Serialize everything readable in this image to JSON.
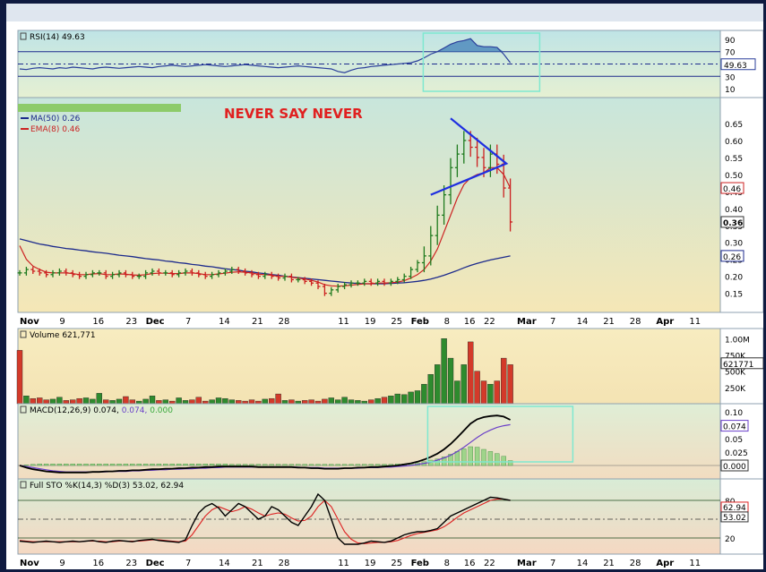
{
  "header": {
    "rsi_label": "RSI(14) 49.63",
    "ma_label": "MA(50) 0.26",
    "ema_label": "EMA(8) 0.46",
    "annotation": "NEVER SAY NEVER",
    "volume_label": "Volume 621,771",
    "macd_name": "MACD(12,26,9)",
    "macd_v1": "0.074,",
    "macd_v2": "0.074,",
    "macd_v3": "0.000",
    "sto_label": "Full STO %K(14,3) %D(3) 53.02, 62.94"
  },
  "colors": {
    "up": "#1e7a1e",
    "down": "#cc1f1f",
    "ma50": "#1c2a8c",
    "ema8": "#cc2222",
    "annotation": "#e02020",
    "triangle": "#1f2fe0",
    "highlight": "#7fe8d0"
  },
  "chart_data": [
    {
      "type": "line",
      "name": "rsi",
      "ylim": [
        0,
        100
      ],
      "yticks": [
        "90",
        "70",
        "50",
        "30",
        "10"
      ],
      "ytick_values": [
        90,
        70,
        50,
        30,
        10
      ],
      "reference_levels": [
        70,
        30
      ],
      "last_value": "49.63",
      "values": [
        42,
        41,
        43,
        44,
        43,
        42,
        44,
        43,
        45,
        44,
        43,
        42,
        44,
        45,
        44,
        43,
        44,
        45,
        46,
        45,
        44,
        46,
        47,
        48,
        47,
        46,
        47,
        48,
        49,
        48,
        47,
        46,
        47,
        48,
        49,
        48,
        47,
        46,
        45,
        44,
        45,
        46,
        47,
        46,
        45,
        44,
        43,
        42,
        38,
        36,
        40,
        43,
        44,
        46,
        47,
        48,
        49,
        50,
        51,
        52,
        55,
        60,
        66,
        70,
        76,
        82,
        86,
        88,
        91,
        80,
        78,
        78,
        77,
        66,
        52
      ]
    },
    {
      "type": "line",
      "name": "price",
      "x_labels": [
        "Nov",
        "9",
        "16",
        "23",
        "Dec",
        "7",
        "14",
        "21",
        "28",
        "11",
        "19",
        "25",
        "Feb",
        "8",
        "16",
        "22",
        "Mar",
        "7",
        "14",
        "21",
        "28",
        "Apr",
        "11"
      ],
      "ylim": [
        0.12,
        0.7
      ],
      "yticks": [
        "0.65",
        "0.60",
        "0.55",
        "0.50",
        "0.45",
        "0.40",
        "0.35",
        "0.30",
        "0.25",
        "0.20",
        "0.15"
      ],
      "ytick_values": [
        0.65,
        0.6,
        0.55,
        0.5,
        0.45,
        0.4,
        0.35,
        0.3,
        0.25,
        0.2,
        0.15
      ],
      "last_price": "0.36",
      "ema_last": "0.46",
      "ma_last": "0.26",
      "close": [
        0.21,
        0.22,
        0.215,
        0.21,
        0.205,
        0.21,
        0.215,
        0.21,
        0.205,
        0.2,
        0.205,
        0.21,
        0.21,
        0.2,
        0.205,
        0.21,
        0.205,
        0.2,
        0.2,
        0.21,
        0.215,
        0.21,
        0.21,
        0.205,
        0.21,
        0.215,
        0.21,
        0.205,
        0.2,
        0.205,
        0.21,
        0.215,
        0.22,
        0.215,
        0.21,
        0.205,
        0.2,
        0.205,
        0.2,
        0.195,
        0.2,
        0.19,
        0.19,
        0.185,
        0.18,
        0.17,
        0.15,
        0.16,
        0.17,
        0.175,
        0.18,
        0.18,
        0.185,
        0.18,
        0.185,
        0.18,
        0.185,
        0.19,
        0.2,
        0.22,
        0.24,
        0.26,
        0.32,
        0.38,
        0.44,
        0.52,
        0.56,
        0.6,
        0.58,
        0.55,
        0.52,
        0.56,
        0.53,
        0.46,
        0.36
      ],
      "ma50": [
        0.31,
        0.305,
        0.3,
        0.295,
        0.292,
        0.288,
        0.285,
        0.282,
        0.28,
        0.277,
        0.275,
        0.272,
        0.27,
        0.268,
        0.265,
        0.262,
        0.26,
        0.258,
        0.255,
        0.252,
        0.25,
        0.248,
        0.245,
        0.243,
        0.24,
        0.238,
        0.235,
        0.233,
        0.23,
        0.228,
        0.225,
        0.222,
        0.22,
        0.218,
        0.215,
        0.213,
        0.21,
        0.208,
        0.205,
        0.203,
        0.2,
        0.198,
        0.196,
        0.194,
        0.192,
        0.19,
        0.188,
        0.186,
        0.184,
        0.182,
        0.18,
        0.179,
        0.178,
        0.178,
        0.178,
        0.178,
        0.179,
        0.18,
        0.181,
        0.183,
        0.185,
        0.188,
        0.192,
        0.197,
        0.203,
        0.21,
        0.217,
        0.225,
        0.232,
        0.238,
        0.243,
        0.248,
        0.252,
        0.256,
        0.26
      ],
      "ema8": [
        0.29,
        0.25,
        0.23,
        0.22,
        0.212,
        0.21,
        0.21,
        0.21,
        0.208,
        0.205,
        0.205,
        0.207,
        0.208,
        0.205,
        0.205,
        0.207,
        0.206,
        0.204,
        0.203,
        0.205,
        0.208,
        0.209,
        0.209,
        0.208,
        0.208,
        0.21,
        0.21,
        0.208,
        0.205,
        0.205,
        0.207,
        0.209,
        0.212,
        0.213,
        0.212,
        0.21,
        0.206,
        0.205,
        0.203,
        0.2,
        0.2,
        0.197,
        0.195,
        0.192,
        0.188,
        0.183,
        0.175,
        0.172,
        0.171,
        0.172,
        0.174,
        0.176,
        0.178,
        0.178,
        0.18,
        0.18,
        0.181,
        0.183,
        0.187,
        0.195,
        0.205,
        0.22,
        0.245,
        0.28,
        0.33,
        0.38,
        0.43,
        0.47,
        0.49,
        0.5,
        0.505,
        0.52,
        0.52,
        0.5,
        0.46
      ]
    },
    {
      "type": "bar",
      "name": "volume",
      "ylim": [
        0,
        1100000
      ],
      "yticks": [
        "1.00M",
        "750K",
        "500K",
        "250K"
      ],
      "ytick_values": [
        1000000,
        750000,
        500000,
        250000
      ],
      "last_value": "621771",
      "values": [
        820000,
        120000,
        80000,
        90000,
        60000,
        70000,
        100000,
        50000,
        60000,
        80000,
        90000,
        70000,
        160000,
        60000,
        50000,
        70000,
        110000,
        60000,
        40000,
        70000,
        120000,
        50000,
        60000,
        40000,
        90000,
        50000,
        60000,
        100000,
        40000,
        60000,
        90000,
        80000,
        60000,
        50000,
        40000,
        60000,
        40000,
        70000,
        80000,
        150000,
        50000,
        60000,
        40000,
        50000,
        60000,
        40000,
        70000,
        90000,
        60000,
        100000,
        60000,
        50000,
        40000,
        60000,
        80000,
        100000,
        120000,
        150000,
        140000,
        180000,
        200000,
        300000,
        450000,
        600000,
        1000000,
        700000,
        350000,
        600000,
        950000,
        500000,
        350000,
        300000,
        350000,
        700000,
        600000
      ]
    },
    {
      "type": "line",
      "name": "macd",
      "ylim": [
        -0.02,
        0.11
      ],
      "yticks": [
        "0.10",
        "0.074",
        "0.05",
        "0.025",
        "0.000"
      ],
      "ytick_values": [
        0.1,
        0.074,
        0.05,
        0.025,
        0.0
      ],
      "macd": [
        0.0,
        -0.004,
        -0.007,
        -0.009,
        -0.011,
        -0.012,
        -0.013,
        -0.013,
        -0.013,
        -0.013,
        -0.013,
        -0.012,
        -0.012,
        -0.011,
        -0.011,
        -0.01,
        -0.01,
        -0.009,
        -0.009,
        -0.008,
        -0.007,
        -0.007,
        -0.006,
        -0.006,
        -0.005,
        -0.005,
        -0.004,
        -0.004,
        -0.003,
        -0.003,
        -0.002,
        -0.002,
        -0.002,
        -0.002,
        -0.002,
        -0.002,
        -0.003,
        -0.003,
        -0.003,
        -0.003,
        -0.003,
        -0.003,
        -0.004,
        -0.004,
        -0.005,
        -0.005,
        -0.006,
        -0.006,
        -0.006,
        -0.005,
        -0.005,
        -0.004,
        -0.004,
        -0.003,
        -0.003,
        -0.002,
        -0.001,
        0.0,
        0.002,
        0.004,
        0.007,
        0.011,
        0.016,
        0.022,
        0.03,
        0.04,
        0.052,
        0.065,
        0.078,
        0.086,
        0.09,
        0.092,
        0.093,
        0.091,
        0.085
      ],
      "signal": [
        0.0,
        -0.002,
        -0.004,
        -0.006,
        -0.008,
        -0.01,
        -0.011,
        -0.012,
        -0.012,
        -0.012,
        -0.012,
        -0.012,
        -0.012,
        -0.012,
        -0.011,
        -0.011,
        -0.011,
        -0.01,
        -0.01,
        -0.009,
        -0.009,
        -0.008,
        -0.008,
        -0.007,
        -0.007,
        -0.006,
        -0.006,
        -0.005,
        -0.005,
        -0.004,
        -0.004,
        -0.003,
        -0.003,
        -0.003,
        -0.003,
        -0.003,
        -0.003,
        -0.003,
        -0.003,
        -0.003,
        -0.003,
        -0.003,
        -0.003,
        -0.004,
        -0.004,
        -0.004,
        -0.005,
        -0.005,
        -0.005,
        -0.005,
        -0.005,
        -0.005,
        -0.004,
        -0.004,
        -0.004,
        -0.003,
        -0.003,
        -0.002,
        -0.001,
        0.0,
        0.002,
        0.004,
        0.006,
        0.01,
        0.014,
        0.019,
        0.026,
        0.034,
        0.043,
        0.052,
        0.06,
        0.066,
        0.071,
        0.074,
        0.076
      ],
      "hist": [
        0.0,
        0.001,
        0.002,
        0.003,
        0.003,
        0.003,
        0.003,
        0.003,
        0.003,
        0.003,
        0.003,
        0.003,
        0.003,
        0.003,
        0.003,
        0.003,
        0.003,
        0.003,
        0.003,
        0.003,
        0.003,
        0.003,
        0.003,
        0.003,
        0.003,
        0.003,
        0.003,
        0.003,
        0.003,
        0.003,
        0.003,
        0.003,
        0.002,
        0.002,
        0.002,
        0.002,
        0.002,
        0.002,
        0.002,
        0.002,
        0.002,
        0.002,
        0.002,
        0.002,
        0.002,
        0.002,
        0.002,
        0.002,
        0.002,
        0.002,
        0.002,
        0.002,
        0.002,
        0.002,
        0.002,
        0.002,
        0.002,
        0.003,
        0.003,
        0.004,
        0.005,
        0.007,
        0.01,
        0.012,
        0.016,
        0.021,
        0.026,
        0.031,
        0.035,
        0.034,
        0.03,
        0.026,
        0.022,
        0.017,
        0.009
      ]
    },
    {
      "type": "line",
      "name": "full_sto",
      "ylim": [
        0,
        100
      ],
      "yticks": [
        "80",
        "62.94",
        "53.02",
        "20"
      ],
      "ytick_values": [
        80,
        62.94,
        53.02,
        20
      ],
      "k": [
        15,
        14,
        13,
        14,
        15,
        14,
        13,
        14,
        15,
        14,
        15,
        16,
        14,
        13,
        15,
        16,
        15,
        14,
        16,
        17,
        18,
        16,
        15,
        14,
        13,
        17,
        40,
        60,
        70,
        75,
        68,
        55,
        65,
        75,
        70,
        60,
        50,
        55,
        70,
        65,
        55,
        45,
        40,
        55,
        70,
        90,
        80,
        50,
        20,
        10,
        10,
        10,
        12,
        15,
        14,
        13,
        15,
        20,
        25,
        28,
        30,
        30,
        32,
        35,
        45,
        55,
        60,
        65,
        70,
        75,
        80,
        85,
        84,
        82,
        80
      ],
      "d": [
        16,
        15,
        14,
        14,
        14,
        14,
        14,
        14,
        14,
        14,
        15,
        15,
        15,
        14,
        14,
        15,
        15,
        15,
        15,
        16,
        17,
        17,
        16,
        15,
        14,
        15,
        25,
        40,
        55,
        65,
        70,
        66,
        62,
        65,
        70,
        66,
        60,
        55,
        58,
        60,
        58,
        52,
        47,
        48,
        55,
        70,
        80,
        70,
        50,
        30,
        18,
        12,
        11,
        12,
        13,
        13,
        14,
        16,
        20,
        24,
        27,
        29,
        31,
        33,
        38,
        45,
        53,
        60,
        65,
        70,
        75,
        80,
        82,
        82,
        80
      ]
    }
  ]
}
